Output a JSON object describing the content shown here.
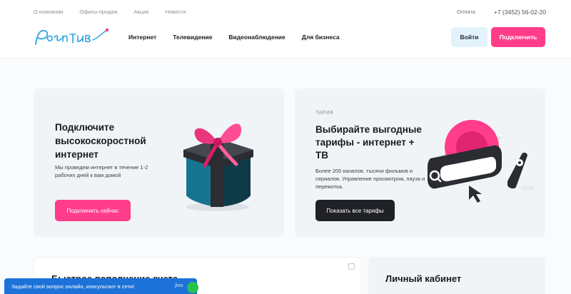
{
  "top_links": [
    "О компании",
    "Офисы продаж",
    "Акции",
    "Новости"
  ],
  "top_right": {
    "payment": "Оплата",
    "phone": "+7 (3452) 56-02-20"
  },
  "nav": [
    "Интернет",
    "Телевидение",
    "Видеонаблюдение",
    "Для бизнеса"
  ],
  "header": {
    "login": "Войти",
    "connect": "Подключить"
  },
  "card1": {
    "title": "Подключите высокоскоростной интернет",
    "text": "Мы проведем интернет в течение 1-2 рабочих дней к вам домой",
    "button": "Подключить сейчас"
  },
  "card2": {
    "eyebrow": "ТАРИФ",
    "title": "Выбирайте выгодные тарифы - интернет + ТВ",
    "text": "Более 200 каналов, тысячи фильмов и сериалов. Управление просмотром, пауза и перемотка.",
    "button": "Показать все тарифы"
  },
  "card3": {
    "title": "Быстрое пополнение счета"
  },
  "card4": {
    "title": "Личный кабинет"
  },
  "chat": {
    "text": "Задайте свой вопрос онлайн, консультант в сети!",
    "extra": "jivo"
  },
  "colors": {
    "accent": "#ff3d8b",
    "dark": "#1f2126",
    "chat": "#1c72d8"
  }
}
